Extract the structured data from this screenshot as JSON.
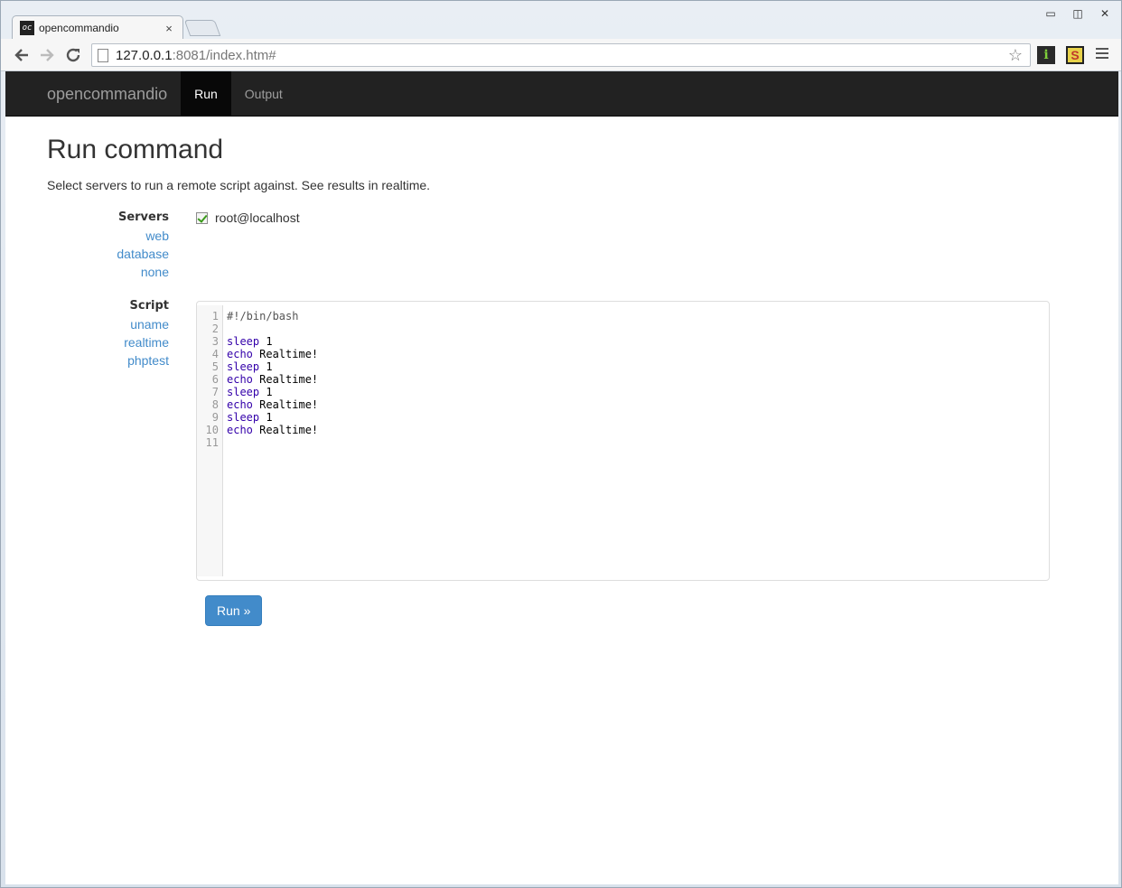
{
  "browser": {
    "tab_title": "opencommandio",
    "tab_favicon": "oc",
    "tab_close": "×",
    "url_host": "127.0.0.1",
    "url_rest": ":8081/index.htm#",
    "window_controls": [
      "▭",
      "◫",
      "✕"
    ]
  },
  "navbar": {
    "brand": "opencommandio",
    "links": [
      {
        "label": "Run",
        "active": true
      },
      {
        "label": "Output",
        "active": false
      }
    ]
  },
  "page": {
    "title": "Run command",
    "description": "Select servers to run a remote script against. See results in realtime."
  },
  "servers": {
    "label": "Servers",
    "presets": [
      "web",
      "database",
      "none"
    ],
    "options": [
      {
        "label": "root@localhost",
        "checked": true
      }
    ]
  },
  "script": {
    "label": "Script",
    "presets": [
      "uname",
      "realtime",
      "phptest"
    ],
    "lines": [
      {
        "n": "1",
        "kw": "",
        "text": "#!/bin/bash",
        "comment": true
      },
      {
        "n": "2",
        "kw": "",
        "text": "",
        "comment": false
      },
      {
        "n": "3",
        "kw": "sleep",
        "text": " 1",
        "comment": false
      },
      {
        "n": "4",
        "kw": "echo",
        "text": " Realtime!",
        "comment": false
      },
      {
        "n": "5",
        "kw": "sleep",
        "text": " 1",
        "comment": false
      },
      {
        "n": "6",
        "kw": "echo",
        "text": " Realtime!",
        "comment": false
      },
      {
        "n": "7",
        "kw": "sleep",
        "text": " 1",
        "comment": false
      },
      {
        "n": "8",
        "kw": "echo",
        "text": " Realtime!",
        "comment": false
      },
      {
        "n": "9",
        "kw": "sleep",
        "text": " 1",
        "comment": false
      },
      {
        "n": "10",
        "kw": "echo",
        "text": " Realtime!",
        "comment": false
      },
      {
        "n": "11",
        "kw": "",
        "text": "",
        "comment": false
      }
    ]
  },
  "run_button": {
    "label": "Run »"
  }
}
